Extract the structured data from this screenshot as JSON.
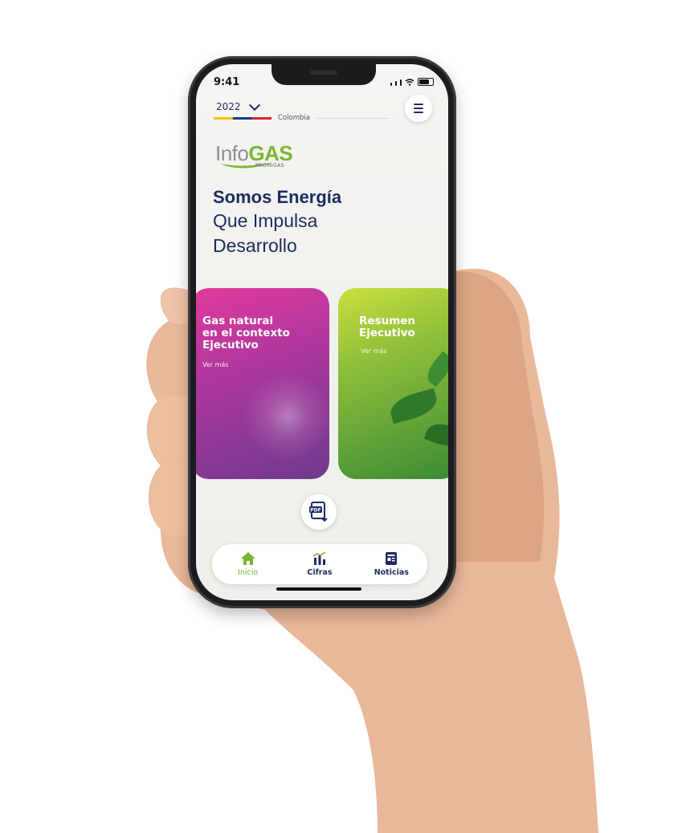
{
  "status_bar": {
    "time": "9:41"
  },
  "header": {
    "year": "2022",
    "country": "Colombia"
  },
  "logo": {
    "info": "Info",
    "gas": "GAS",
    "sub": "PROMIGAS"
  },
  "headline": {
    "line1": "Somos Energía",
    "line2": "Que Impulsa",
    "line3": "Desarrollo"
  },
  "cards": [
    {
      "title": "Gas natural en el contexto Ejecutivo",
      "title_lines": [
        "Gas natural",
        "en el contexto",
        "Ejecutivo"
      ],
      "more": "Ver más"
    },
    {
      "title": "Resumen Ejecutivo",
      "title_lines": [
        "Resumen",
        "Ejecutivo"
      ],
      "more": "Ver más"
    }
  ],
  "pdf_button": {
    "label": "PDF"
  },
  "nav": {
    "items": [
      {
        "label": "Inicio",
        "icon": "home-icon",
        "active": true
      },
      {
        "label": "Cifras",
        "icon": "chart-icon",
        "active": false
      },
      {
        "label": "Noticias",
        "icon": "news-icon",
        "active": false
      }
    ]
  },
  "colors": {
    "brand_navy": "#1d2b5e",
    "brand_green": "#7ab634",
    "card1": "#c0379c",
    "card2": "#7fb83a"
  }
}
